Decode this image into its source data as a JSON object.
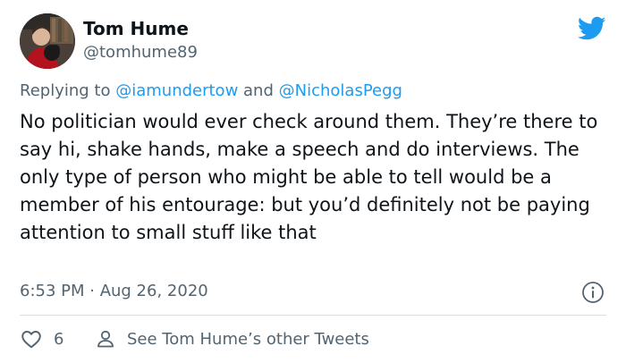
{
  "author": {
    "name": "Tom Hume",
    "handle": "@tomhume89"
  },
  "reply": {
    "prefix": "Replying to",
    "mentions": [
      "@iamundertow",
      "@NicholasPegg"
    ],
    "joiner": "and"
  },
  "tweet": {
    "text": "No politician would ever check around them. They’re there to say hi, shake hands, make a speech and do interviews. The only type of person who might be able to tell would be a member of his entourage: but you’d definitely not be paying attention to small stuff like that",
    "timestamp": "6:53 PM · Aug 26, 2020"
  },
  "actions": {
    "like_count": "6",
    "profile_label": "See Tom Hume’s other Tweets"
  },
  "icons": {
    "brand": "twitter-bird-icon",
    "info": "info-icon",
    "like": "heart-icon",
    "profile": "person-icon"
  },
  "colors": {
    "brand_blue": "#1d9bf0",
    "secondary_text": "#536471",
    "primary_text": "#0f1419",
    "divider": "#d9dfe3"
  }
}
